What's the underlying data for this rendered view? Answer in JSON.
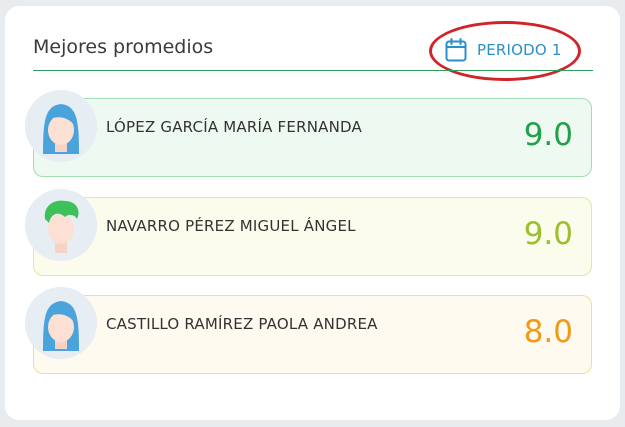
{
  "header": {
    "title": "Mejores promedios",
    "period_label": "PERIODO 1"
  },
  "colors": {
    "accent_green": "#2e9e5b",
    "period_blue": "#2b8fc9",
    "highlight_red": "#d0242a"
  },
  "students": [
    {
      "name": "LÓPEZ GARCÍA MARÍA FERNANDA",
      "score": "9.0",
      "score_color": "#22a04a",
      "avatar": "female-blue-hair-icon"
    },
    {
      "name": "NAVARRO PÉREZ MIGUEL ÁNGEL",
      "score": "9.0",
      "score_color": "#9bbf2e",
      "avatar": "male-green-hair-icon"
    },
    {
      "name": "CASTILLO RAMÍREZ PAOLA ANDREA",
      "score": "8.0",
      "score_color": "#f09a19",
      "avatar": "female-blue-hair-icon"
    }
  ]
}
